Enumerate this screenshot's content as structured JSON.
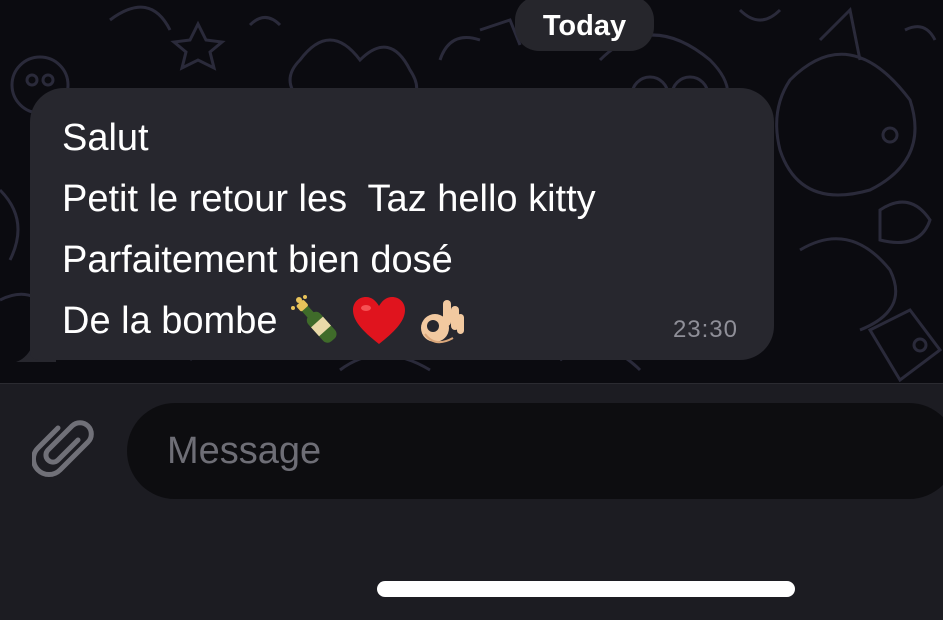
{
  "chat": {
    "date_label": "Today",
    "message": {
      "lines": [
        "Salut",
        "Petit le retour les  Taz hello kitty",
        "Parfaitement bien dosé",
        "De la bombe"
      ],
      "emojis": [
        "champagne-bottle",
        "red-heart",
        "ok-hand"
      ],
      "time": "23:30"
    }
  },
  "composer": {
    "placeholder": "Message",
    "attach_icon": "paperclip-icon"
  },
  "colors": {
    "bubble": "#27272e",
    "chat_background": "#0b0b10",
    "input_bar": "#1c1c22",
    "text": "#ffffff",
    "timestamp": "#8f8f98",
    "placeholder": "#6e6e76"
  }
}
